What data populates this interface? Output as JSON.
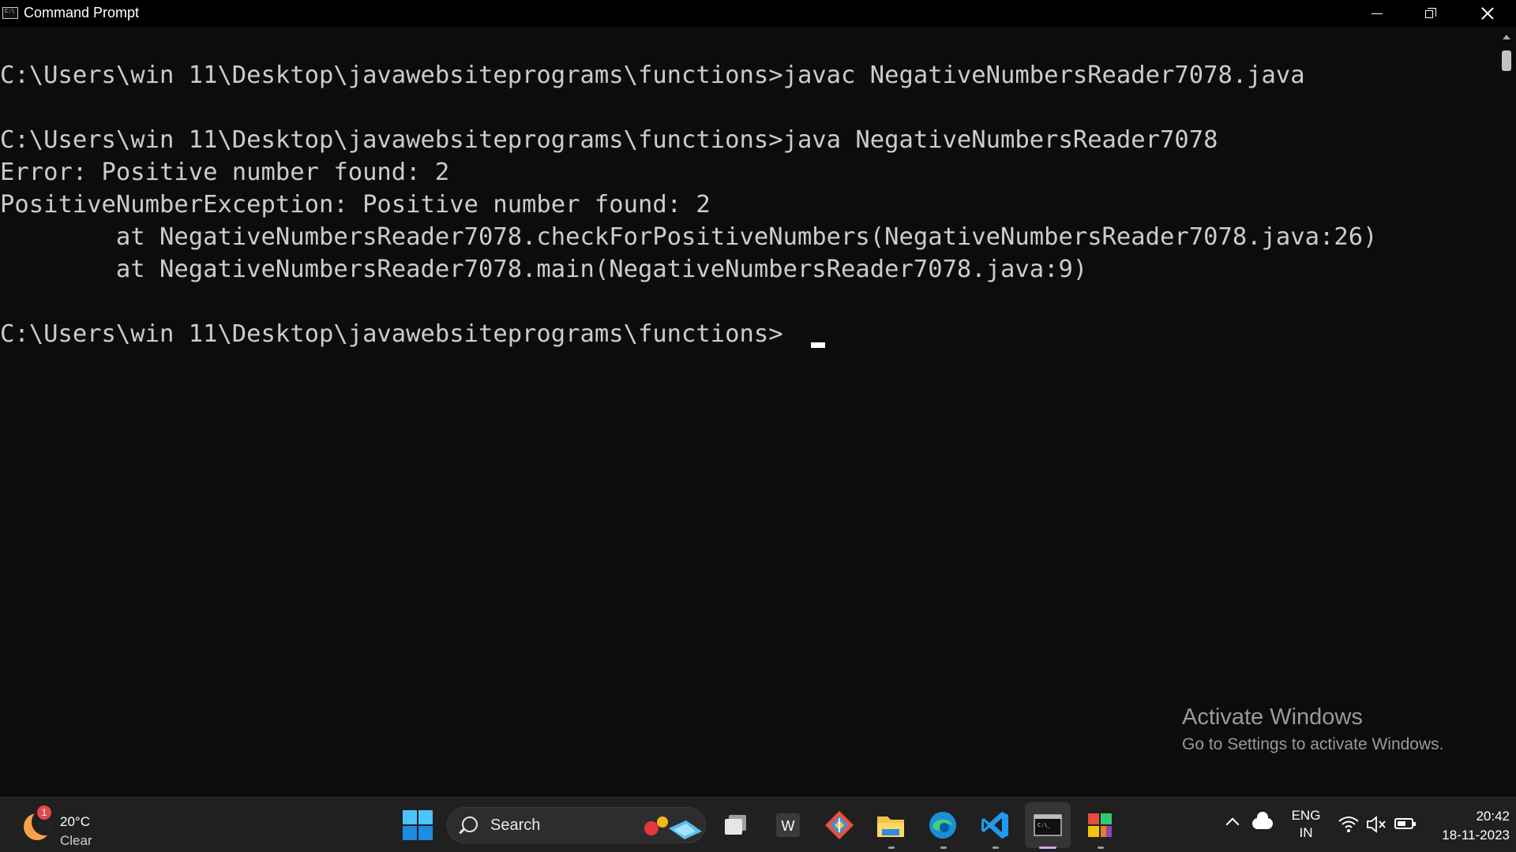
{
  "window": {
    "title": "Command Prompt"
  },
  "console": {
    "lines": [
      "",
      "C:\\Users\\win 11\\Desktop\\javawebsiteprograms\\functions>javac NegativeNumbersReader7078.java",
      "",
      "C:\\Users\\win 11\\Desktop\\javawebsiteprograms\\functions>java NegativeNumbersReader7078",
      "Error: Positive number found: 2",
      "PositiveNumberException: Positive number found: 2",
      "        at NegativeNumbersReader7078.checkForPositiveNumbers(NegativeNumbersReader7078.java:26)",
      "        at NegativeNumbersReader7078.main(NegativeNumbersReader7078.java:9)",
      "",
      "C:\\Users\\win 11\\Desktop\\javawebsiteprograms\\functions>"
    ],
    "text_color": "#cccccc",
    "background": "#0c0c0c"
  },
  "watermark": {
    "title": "Activate Windows",
    "subtitle": "Go to Settings to activate Windows."
  },
  "taskbar": {
    "weather": {
      "badge": "1",
      "temperature": "20°C",
      "condition": "Clear",
      "icon": "moon-icon"
    },
    "search": {
      "label": "Search"
    },
    "apps": [
      {
        "name": "task-view",
        "icon": "task-view-icon"
      },
      {
        "name": "word",
        "icon": "word-icon",
        "glyph": "W"
      },
      {
        "name": "git",
        "icon": "git-icon"
      },
      {
        "name": "file-explorer",
        "icon": "folder-icon"
      },
      {
        "name": "edge",
        "icon": "edge-icon"
      },
      {
        "name": "vscode",
        "icon": "vscode-icon"
      },
      {
        "name": "command-prompt",
        "icon": "terminal-icon"
      },
      {
        "name": "office-app",
        "icon": "office-icon"
      }
    ],
    "tray": {
      "language_line1": "ENG",
      "language_line2": "IN",
      "time": "20:42",
      "date": "18-11-2023"
    }
  }
}
